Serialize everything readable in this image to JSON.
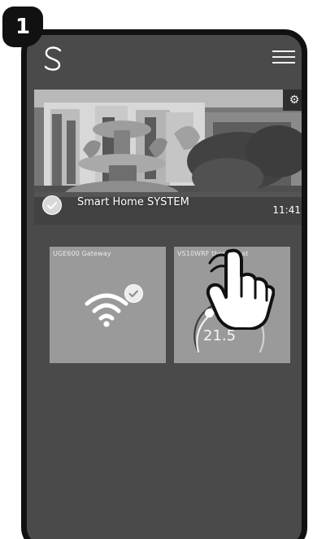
{
  "step": {
    "number": "1"
  },
  "app": {
    "logo_icon": "swirl-s-logo-icon",
    "menu_icon": "hamburger-menu-icon"
  },
  "banner": {
    "title": "Smart Home SYSTEM",
    "time": "11:41",
    "settings_icon": "gear-icon",
    "status_icon": "check-circle-icon"
  },
  "devices": [
    {
      "title": "UGE600 Gateway",
      "icon": "wifi-icon",
      "status_icon": "check-circle-icon"
    },
    {
      "title": "VS10WRF thermostat",
      "temperature": "21.5",
      "icon": "thermostat-gauge-icon"
    }
  ],
  "overlay": {
    "pointer_icon": "tap-hand-icon"
  },
  "colors": {
    "screen_background": "#4a4a4a",
    "tile_background": "#9a9a9a",
    "frame": "#111111"
  }
}
